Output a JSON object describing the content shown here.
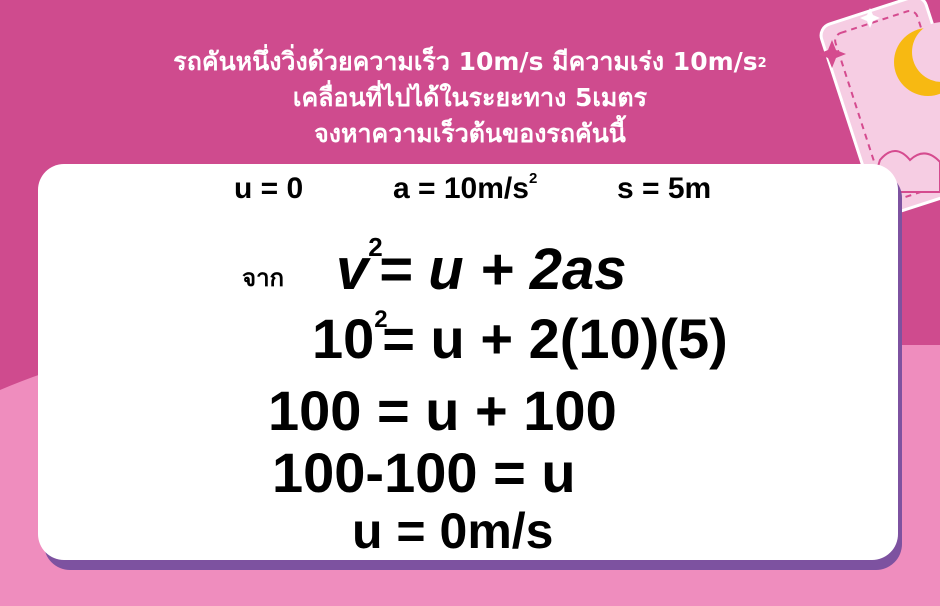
{
  "question": {
    "line1_text": "รถคันหนึ่งวิ่งด้วยความเร็ว 10m/s มีความเร่ง 10m/s",
    "line1_sup": "2",
    "line2": "เคลื่อนที่ไปได้ในระยะทาง 5เมตร",
    "line3": "จงหาความเร็วต้นของรถคันนี้"
  },
  "givens": {
    "u": "u = 0",
    "a_text": "a = 10m/s",
    "a_sup": "2",
    "s": "s = 5m"
  },
  "solution": {
    "from_label": "จาก",
    "formula_v": "v",
    "formula_sup": "2",
    "formula_rest": "= u + 2as",
    "step1_base": "10",
    "step1_sup": "2",
    "step1_rest": "= u + 2(10)(5)",
    "step2": "100 = u + 100",
    "step3": "100-100 = u",
    "answer": "u = 0m/s"
  },
  "colors": {
    "background_top": "#cf4b8e",
    "background_bottom": "#ef8dbe",
    "card": "#ffffff",
    "card_shadow": "#7d52a0",
    "header_text": "#ffffff",
    "moon": "#f7b912"
  }
}
